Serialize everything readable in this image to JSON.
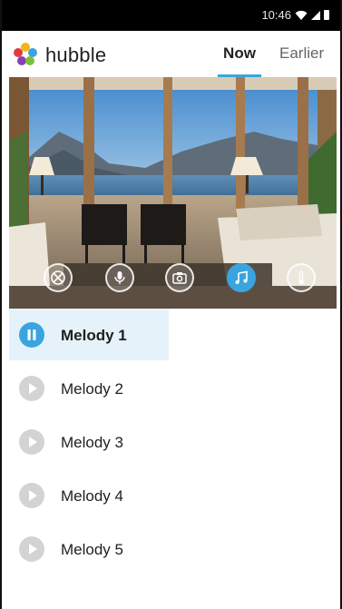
{
  "status_bar": {
    "time": "10:46"
  },
  "header": {
    "app_name": "hubble",
    "tabs": [
      {
        "label": "Now",
        "active": true
      },
      {
        "label": "Earlier",
        "active": false
      }
    ]
  },
  "camera": {
    "controls": [
      {
        "icon": "pan-tilt-icon",
        "active": false
      },
      {
        "icon": "microphone-icon",
        "active": false
      },
      {
        "icon": "camera-icon",
        "active": false
      },
      {
        "icon": "music-note-icon",
        "active": true
      },
      {
        "icon": "thermometer-icon",
        "active": false
      }
    ]
  },
  "melodies": [
    {
      "label": "Melody 1",
      "state": "playing"
    },
    {
      "label": "Melody 2",
      "state": "stopped"
    },
    {
      "label": "Melody 3",
      "state": "stopped"
    },
    {
      "label": "Melody 4",
      "state": "stopped"
    },
    {
      "label": "Melody 5",
      "state": "stopped"
    }
  ],
  "colors": {
    "accent": "#3aa4e0",
    "selected_row": "#e6f2fa",
    "inactive_button": "#d3d3d3"
  }
}
